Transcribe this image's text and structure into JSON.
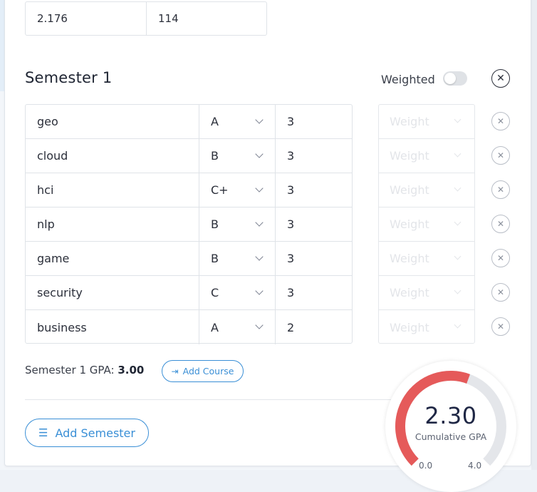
{
  "top_row": {
    "gpa_value": "2.176",
    "credits_value": "114"
  },
  "semester": {
    "title": "Semester 1",
    "weighted_label": "Weighted",
    "weighted_on": false,
    "courses": [
      {
        "name": "geo",
        "grade": "A",
        "credits": "3",
        "weight_placeholder": "Weight"
      },
      {
        "name": "cloud",
        "grade": "B",
        "credits": "3",
        "weight_placeholder": "Weight"
      },
      {
        "name": "hci",
        "grade": "C+",
        "credits": "3",
        "weight_placeholder": "Weight"
      },
      {
        "name": "nlp",
        "grade": "B",
        "credits": "3",
        "weight_placeholder": "Weight"
      },
      {
        "name": "game",
        "grade": "B",
        "credits": "3",
        "weight_placeholder": "Weight"
      },
      {
        "name": "security",
        "grade": "C",
        "credits": "3",
        "weight_placeholder": "Weight"
      },
      {
        "name": "business",
        "grade": "A",
        "credits": "2",
        "weight_placeholder": "Weight"
      }
    ],
    "gpa_label": "Semester 1 GPA:",
    "gpa_value": "3.00",
    "add_course_label": "Add Course"
  },
  "add_semester_label": "Add Semester",
  "cumulative": {
    "value": 2.3,
    "value_text": "2.30",
    "label": "Cumulative GPA",
    "min_label": "0.0",
    "max_label": "4.0",
    "min": 0,
    "max": 4,
    "fill_color": "#e55a5a",
    "track_color": "#e4e6ea"
  },
  "icons": {
    "remove": "close-icon",
    "dropdown": "chevron-down-icon",
    "add_course": "add-course-icon",
    "add_semester": "add-list-icon"
  }
}
